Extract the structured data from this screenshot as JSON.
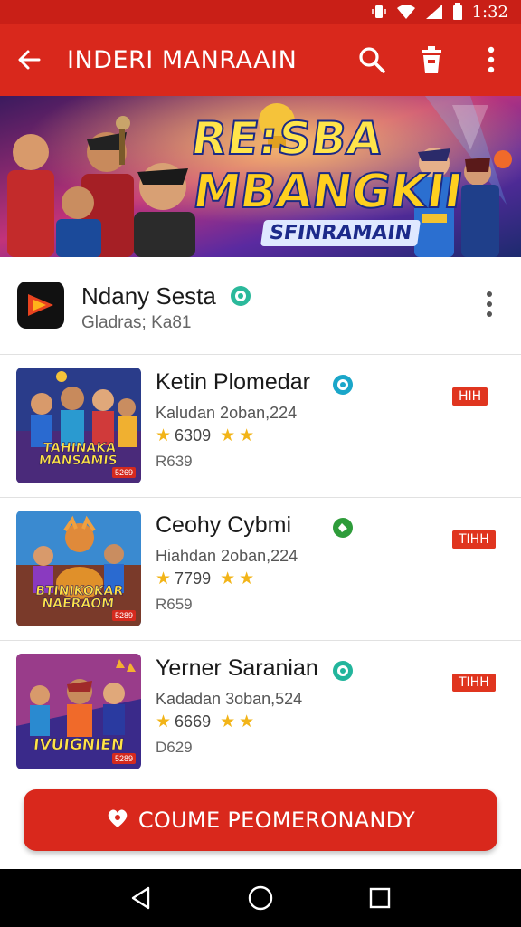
{
  "status_bar": {
    "time": "1:32",
    "icons": [
      "vibrate-icon",
      "wifi-icon",
      "signal-icon",
      "battery-icon"
    ]
  },
  "app_bar": {
    "title": "INDERI MANRAAIN",
    "back_icon": "arrow-back-icon",
    "actions": [
      "search-icon",
      "delete-icon",
      "more-vert-icon"
    ]
  },
  "banner": {
    "line1": "RE:SBA",
    "line2": "MBANGKII",
    "line3": "SFINRAMAIN"
  },
  "publisher": {
    "name": "Ndany Sesta",
    "subtitle": "Gladras; Ka81",
    "verified_color": "#2bb99b"
  },
  "apps": [
    {
      "title": "Ketin Plomedar",
      "meta": "Kaludan 2oban,224",
      "rating": "6309",
      "price": "R639",
      "tag": "HIH",
      "thumb_caption": "TAHINAKA MANSAMIS",
      "thumb_tag": "5269",
      "badge_color": "#1aa6c9"
    },
    {
      "title": "Ceohy Cybmi",
      "meta": "Hiahdan 2oban,224",
      "rating": "7799",
      "price": "R659",
      "tag": "TIHH",
      "thumb_caption": "BTINIKOKAR NAERAOM",
      "thumb_tag": "5289",
      "badge_color": "#2e9c3a"
    },
    {
      "title": "Yerner Saranian",
      "meta": "Kadadan 3oban,524",
      "rating": "6669",
      "price": "D629",
      "tag": "TIHH",
      "thumb_caption": "IVUIGNIEN",
      "thumb_tag": "5289",
      "badge_color": "#22b59c"
    }
  ],
  "cta": {
    "label": "COUME PEOMERONANDY",
    "icon": "heart-icon"
  },
  "nav_bar": {
    "buttons": [
      "back-triangle-icon",
      "home-circle-icon",
      "recents-square-icon"
    ]
  },
  "colors": {
    "primary": "#d9281c",
    "status_bar": "#c91f17",
    "star": "#f2b418"
  }
}
